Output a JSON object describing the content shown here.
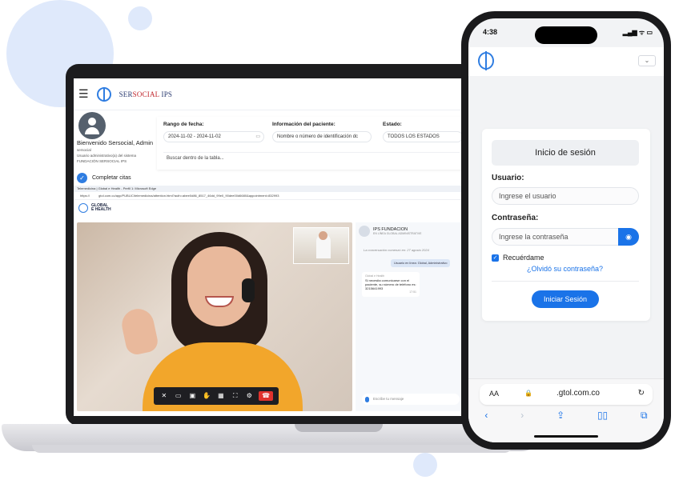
{
  "laptop": {
    "brand": {
      "prefix": "SER",
      "accent": "SOCIAL",
      "suffix": " IPS"
    },
    "user": {
      "welcome": "Bienvenido Sersocial, Admin",
      "line1": "sersocial",
      "line2": "Usuario administrativo(a) del sistema",
      "line3": "FUNDACIÓN SERSOCIAL IPS"
    },
    "sidebar_item": "Completar citas",
    "filters": {
      "date_label": "Rango de fecha:",
      "date_value": "2024-11-02 - 2024-11-02",
      "patient_label": "Información del paciente:",
      "patient_placeholder": "Nombre o número de identificación dc",
      "status_label": "Estado:",
      "status_value": "TODOS LOS ESTADOS",
      "search_placeholder": "Buscar dentro de la tabla..."
    },
    "edge": {
      "tab_title": "Telemedicina | Global e Health - Perfil 1: Microsoft Edge",
      "url_prefix": "https://",
      "url": "gtol.com.co/app/PUBLIC/telemedicina/attention.html?auth=abee0d86_8517_46dd_99e0_90dee00d6680&appointment=832993"
    },
    "geh": {
      "line1": "GLOBAL",
      "line2": "E HEALTH"
    },
    "chat": {
      "name": "IPS FUNDACION",
      "subtitle": "EN LÍNEA GLOBAL ADMINISTRATIVE",
      "note": "La conversación comenzó en: 27 agosto 2024",
      "me": "Usuario en línea: Global, Administrativo",
      "bubble_from": "Global e Health",
      "bubble_text": "Si necesita comunicarse con el paciente, su número de teléfono es: 3215641993",
      "bubble_time": "17:51",
      "input_placeholder": "Escribe tu mensaje"
    }
  },
  "phone": {
    "time": "4:38",
    "signal": "▂▄▆ ᯤ ▭",
    "title": "Inicio de sesión",
    "user_label": "Usuario:",
    "user_placeholder": "Ingrese el usuario",
    "pass_label": "Contraseña:",
    "pass_placeholder": "Ingrese la contraseña",
    "remember": "Recuérdame",
    "forgot": "¿Olvidó su contraseña?",
    "login": "Iniciar Sesión",
    "url": ".gtol.com.co",
    "aa": "AA"
  },
  "colors": {
    "accent": "#1a73e8",
    "blob": "#dfe9fb",
    "end_call": "#e0322d"
  }
}
